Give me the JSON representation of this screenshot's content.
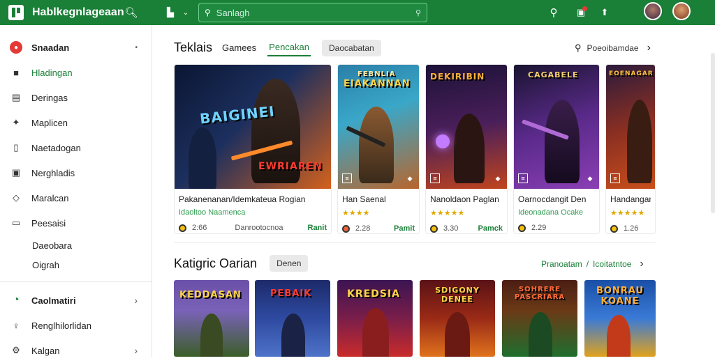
{
  "topbar": {
    "title": "Hablkegnlageaan",
    "search_placeholder": "Sanlagh"
  },
  "sidebar": {
    "items": [
      {
        "label": "Snaadan",
        "icon": "red-circle-icon"
      },
      {
        "label": "Hladingan",
        "icon": "folder-icon"
      },
      {
        "label": "Deringas",
        "icon": "book-icon"
      },
      {
        "label": "Maplicen",
        "icon": "gear-icon"
      },
      {
        "label": "Naetadogan",
        "icon": "bookmark-icon"
      },
      {
        "label": "Nerghladis",
        "icon": "image-icon"
      },
      {
        "label": "Maralcan",
        "icon": "tag-icon"
      },
      {
        "label": "Peesaisi",
        "icon": "screen-icon"
      }
    ],
    "sub_items": [
      "Daeobara",
      "Oigrah"
    ],
    "bottom_items": [
      {
        "label": "Caolmatiri",
        "icon": "green-circle-icon"
      },
      {
        "label": "Renglhilorlidan",
        "icon": "person-icon"
      },
      {
        "label": "Kalgan",
        "icon": "settings-icon"
      }
    ]
  },
  "section1": {
    "title": "Teklais",
    "tabs": [
      "Gamees",
      "Pencakan"
    ],
    "chip": "Daocabatan",
    "right_label": "Poeoibamdae",
    "cards": [
      {
        "art_title": "BAIGINEI",
        "art_sub": "EWRIAREN",
        "name": "Pakanenanan/Idemkateua Rogian",
        "sub": "Idaoltoo Naamenca",
        "rating": "2:66",
        "extra": "Danrootocnoa",
        "price": "Ranit",
        "colors": [
          "#0e1c3a",
          "#d95a14"
        ]
      },
      {
        "art_title": "EIAKANNAN",
        "art_sub": "FEBNLIA",
        "name": "Han Saenal",
        "sub": "★★★★",
        "rating": "2.28",
        "price": "Pamit",
        "colors": [
          "#3aa7c8",
          "#b86a2c"
        ]
      },
      {
        "art_title": "DEKIRIBIN",
        "art_sub": "",
        "name": "Nanoldaon Paglan",
        "sub": "★★★★★",
        "rating": "3.30",
        "price": "Pamck",
        "colors": [
          "#2a1a46",
          "#c0441d"
        ]
      },
      {
        "art_title": "CAGABELE",
        "art_sub": "",
        "name": "Oarnocdangit Den",
        "sub": "Ideonadana Ocake",
        "rating": "2.29",
        "price": "",
        "colors": [
          "#1c1630",
          "#8b3fb5"
        ]
      },
      {
        "art_title": "EOENAGAR",
        "art_sub": "",
        "name": "Handangan",
        "sub": "★★★★★",
        "rating": "1.26",
        "price": "",
        "colors": [
          "#2b1b3c",
          "#c94f1b"
        ]
      }
    ]
  },
  "section2": {
    "title": "Katigric Oarian",
    "chip": "Denen",
    "right_label_a": "Pranoatam",
    "right_label_b": "Icoitatntoe",
    "cards": [
      {
        "art_title": "KEDDASAN",
        "colors": [
          "#6b4fa8",
          "#3b5e28"
        ]
      },
      {
        "art_title": "PEBAIK",
        "colors": [
          "#1d2a6a",
          "#4e73c9"
        ]
      },
      {
        "art_title": "KREDSIA",
        "colors": [
          "#3b1452",
          "#c92b2b"
        ]
      },
      {
        "art_title": "SDIGONY DENEE",
        "colors": [
          "#5a1216",
          "#e0731d"
        ]
      },
      {
        "art_title": "SOHRERE PASCRIARA",
        "colors": [
          "#4b1d14",
          "#1f6e2e"
        ]
      },
      {
        "art_title": "BONRAU KOANE",
        "colors": [
          "#1a4fa6",
          "#e0a21d"
        ]
      }
    ]
  }
}
